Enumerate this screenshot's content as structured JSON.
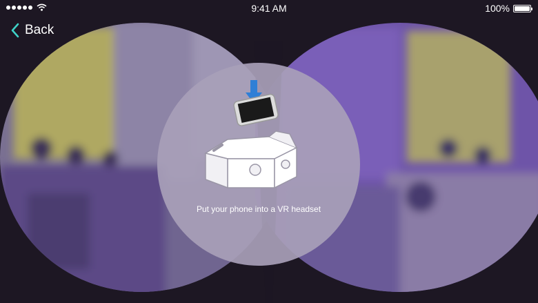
{
  "status_bar": {
    "signal_icon": "signal-dots-icon",
    "wifi_icon": "wifi-icon",
    "time": "9:41 AM",
    "battery_percent": "100%",
    "battery_level": 1.0,
    "battery_icon": "battery-icon"
  },
  "navigation": {
    "back_label": "Back",
    "back_icon": "chevron-left-icon"
  },
  "colors": {
    "accent": "#3fd3c8",
    "overlay": "#a8a0b8",
    "scene_left": "#8a7fa0",
    "scene_right": "#7b5fb5"
  },
  "prompt": {
    "illustration_icon": "phone-into-headset-icon",
    "arrow_icon": "arrow-down-icon",
    "text": "Put your phone into a VR headset"
  }
}
